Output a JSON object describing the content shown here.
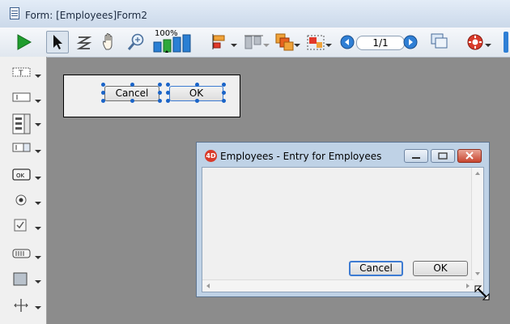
{
  "window": {
    "title": "Form: [Employees]Form2"
  },
  "toolbar": {
    "zoom_label": "100%",
    "page_indicator": "1/1",
    "tools": [
      "play-icon",
      "pointer-icon",
      "entry-order-icon",
      "hand-icon",
      "zoom-icon",
      "zoom-level-icon",
      "align-icon",
      "distribute-icon",
      "layer-icon",
      "group-icon",
      "prev-page-icon",
      "next-page-icon",
      "views-icon",
      "macros-icon"
    ]
  },
  "palette": {
    "items": [
      "text-object-icon",
      "field-icon",
      "list-icon",
      "combo-icon",
      "button-icon",
      "radio-icon",
      "checkbox-icon",
      "ruler-icon",
      "rectangle-icon",
      "splitter-icon"
    ]
  },
  "form": {
    "cancel_label": "Cancel",
    "ok_label": "OK"
  },
  "dialog": {
    "title": "Employees - Entry for Employees",
    "cancel_label": "Cancel",
    "ok_label": "OK"
  },
  "colors": {
    "canvas": "#8c8c8c",
    "selection": "#1a64c8",
    "play": "#1f9d2e"
  }
}
